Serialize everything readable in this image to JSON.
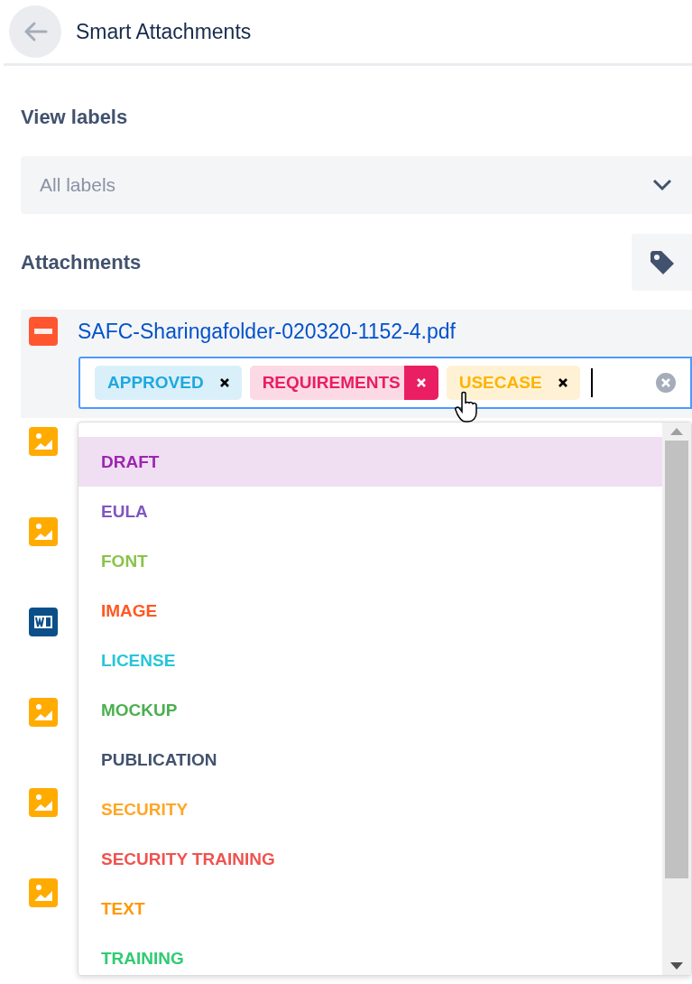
{
  "header": {
    "title": "Smart Attachments"
  },
  "view_labels": {
    "heading": "View labels",
    "select": {
      "placeholder": "All labels"
    }
  },
  "attachments": {
    "heading": "Attachments",
    "items": [
      {
        "kind": "pdf",
        "name": "SAFC-Sharingafolder-020320-1152-4.pdf",
        "tags": [
          {
            "label": "APPROVED",
            "color": "#1fa8e0",
            "hovered": false
          },
          {
            "label": "REQUIREMENTS",
            "color": "#e91e63",
            "hovered": true
          },
          {
            "label": "USECASE",
            "color": "#ffb300",
            "hovered": false
          }
        ]
      },
      {
        "kind": "image"
      },
      {
        "kind": "image"
      },
      {
        "kind": "word"
      },
      {
        "kind": "image"
      },
      {
        "kind": "image"
      },
      {
        "kind": "image"
      }
    ]
  },
  "label_menu": [
    {
      "label": "DRAFT",
      "color": "#9c27b0",
      "selected": true
    },
    {
      "label": "EULA",
      "color": "#7e57c2",
      "selected": false
    },
    {
      "label": "FONT",
      "color": "#8bc34a",
      "selected": false
    },
    {
      "label": "IMAGE",
      "color": "#ff5722",
      "selected": false
    },
    {
      "label": "LICENSE",
      "color": "#26c6da",
      "selected": false
    },
    {
      "label": "MOCKUP",
      "color": "#4caf50",
      "selected": false
    },
    {
      "label": "PUBLICATION",
      "color": "#42526e",
      "selected": false
    },
    {
      "label": "SECURITY",
      "color": "#ffa726",
      "selected": false
    },
    {
      "label": "SECURITY TRAINING",
      "color": "#ef5350",
      "selected": false
    },
    {
      "label": "TEXT",
      "color": "#ff9800",
      "selected": false
    },
    {
      "label": "TRAINING",
      "color": "#2ecc71",
      "selected": false
    }
  ]
}
